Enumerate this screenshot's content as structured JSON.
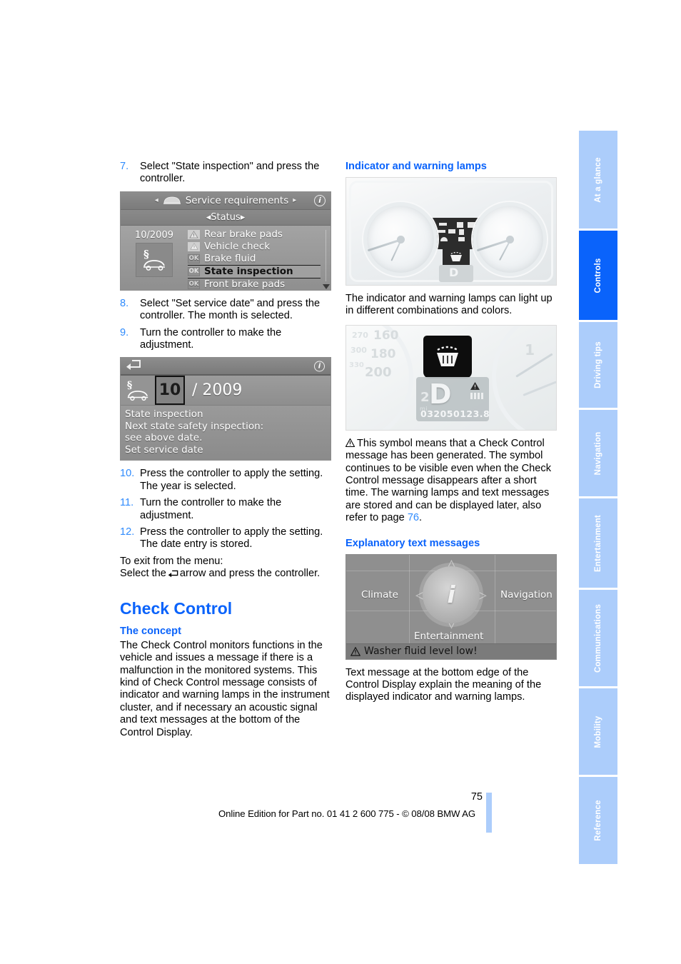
{
  "document": {
    "page_number": "75",
    "footer_note": "Online Edition for Part no. 01 41 2 600 775 - © 08/08 BMW AG",
    "accent_blue": "#0a63fb",
    "tab_inactive_blue": "#accdfb"
  },
  "tabs": [
    {
      "label": "At a glance",
      "active": false
    },
    {
      "label": "Controls",
      "active": true
    },
    {
      "label": "Driving tips",
      "active": false
    },
    {
      "label": "Navigation",
      "active": false
    },
    {
      "label": "Entertainment",
      "active": false
    },
    {
      "label": "Communications",
      "active": false
    },
    {
      "label": "Mobility",
      "active": false
    },
    {
      "label": "Reference",
      "active": false
    }
  ],
  "left_column": {
    "steps": [
      {
        "num": "7.",
        "text": "Select \"State inspection\" and press the controller."
      },
      {
        "num": "8.",
        "text": "Select \"Set service date\" and press the controller. The month is selected."
      },
      {
        "num": "9.",
        "text": "Turn the controller to make the adjustment."
      },
      {
        "num": "10.",
        "text": "Press the controller to apply the setting. The year is selected."
      },
      {
        "num": "11.",
        "text": "Turn the controller to make the adjustment."
      },
      {
        "num": "12.",
        "text": "Press the controller to apply the setting. The date entry is stored."
      }
    ],
    "exit_line1": "To exit from the menu:",
    "exit_line2_before": "Select the",
    "exit_line2_after": "arrow and press the controller.",
    "section_title": "Check Control",
    "sub_title": "The concept",
    "concept_paragraph": "The Check Control monitors functions in the vehicle and issues a message if there is a malfunction in the monitored systems. This kind of Check Control message consists of indicator and warning lamps in the instrument cluster, and if necessary an acoustic signal and text messages at the bottom of the Control Display."
  },
  "figure_service_requirements": {
    "title_bar": "Service requirements",
    "sub_bar": "Status",
    "date": "10/2009",
    "info_icon": "i",
    "rows": [
      {
        "badge": "warn",
        "badge_text": "",
        "label": "Rear brake pads",
        "selected": false
      },
      {
        "badge": "warn",
        "badge_text": "",
        "label": "Vehicle check",
        "selected": false
      },
      {
        "badge": "ok",
        "badge_text": "OK",
        "label": "Brake fluid",
        "selected": false
      },
      {
        "badge": "ok",
        "badge_text": "OK",
        "label": "State inspection",
        "selected": true
      },
      {
        "badge": "ok",
        "badge_text": "OK",
        "label": "Front brake pads",
        "selected": false
      }
    ]
  },
  "figure_set_service_date": {
    "month": "10",
    "separator_year": "/ 2009",
    "info_icon": "i",
    "lines": [
      "State inspection",
      "Next state safety inspection:",
      "see above date.",
      "Set service date"
    ]
  },
  "right_column": {
    "heading_indicator": "Indicator and warning lamps",
    "caption_indicator": "The indicator and warning lamps can light up in different combinations and colors.",
    "warning_paragraph_part1": "This symbol means that a Check Control message has been generated. The symbol continues to be visible even when the Check Control message disappears after a short time. The warning lamps and text messages are stored and can be displayed later, also refer to page ",
    "warning_paragraph_link": "76",
    "warning_paragraph_part2": ".",
    "heading_explanatory": "Explanatory text messages",
    "caption_explanatory": "Text message at the bottom edge of the Control Display explain the meaning of the displayed indicator and warning lamps."
  },
  "figure_cluster_closeup": {
    "gear_indicator": "D",
    "gear_number": "2",
    "unit": "mi",
    "odometer": "032050",
    "trip": "123.8",
    "speedo_values": [
      "270",
      "160",
      "300",
      "180",
      "330",
      "200"
    ],
    "tach_value": "1"
  },
  "figure_control_display": {
    "menu_left": "Climate",
    "menu_right": "Navigation",
    "menu_bottom": "Entertainment",
    "center_icon": "i",
    "status_message": "Washer fluid level low!"
  }
}
